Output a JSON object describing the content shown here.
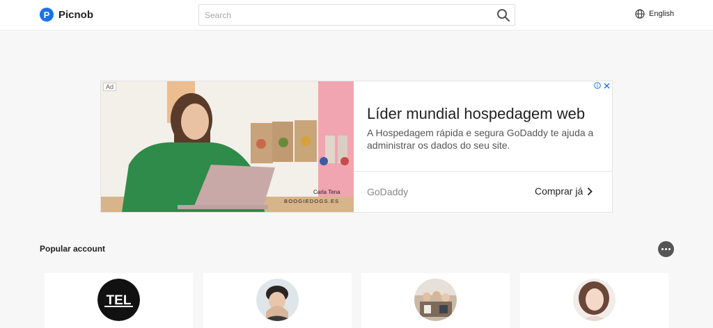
{
  "header": {
    "logo_letter": "P",
    "app_name": "Picnob",
    "search_placeholder": "Search",
    "language": "English"
  },
  "ad": {
    "badge": "Ad",
    "photo_caption_name": "Carla Tena",
    "photo_caption_brand": "BOOGIEDOGS.ES",
    "title": "Líder mundial hospedagem web",
    "description": "A Hospedagem rápida e segura GoDaddy te ajuda a administrar os dados do seu site.",
    "advertiser": "GoDaddy",
    "cta": "Comprar já"
  },
  "popular": {
    "title": "Popular account",
    "accounts": [
      {
        "avatar_text": "TEL"
      },
      {
        "avatar_text": ""
      },
      {
        "avatar_text": ""
      },
      {
        "avatar_text": ""
      }
    ]
  },
  "colors": {
    "brand": "#1a73e8",
    "page_bg": "#f7f7f7",
    "more_button": "#555555"
  }
}
